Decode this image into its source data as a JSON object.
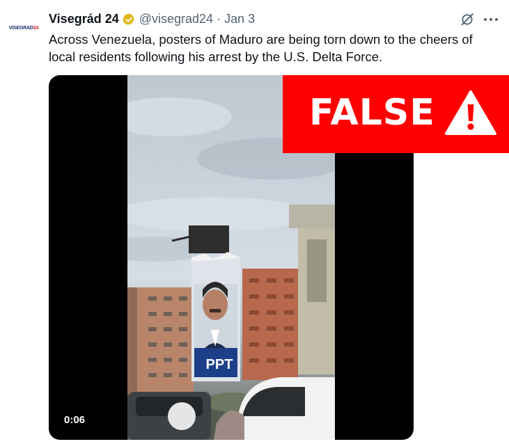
{
  "tweet": {
    "avatar_text_a": "VISEGRAD",
    "avatar_text_b": "24",
    "author_name": "Visegrád 24",
    "handle": "@visegrad24",
    "separator": "·",
    "date": "Jan 3",
    "text": "Across Venezuela, posters of Maduro are being torn down to the cheers of local residents following his arrest by the U.S. Delta Force."
  },
  "media": {
    "video_time": "0:06",
    "poster_text": "PPT"
  },
  "overlay": {
    "label": "FALSE",
    "color": "#ff0000"
  },
  "icons": [
    "verified-badge-icon",
    "grok-icon",
    "more-icon",
    "warning-icon"
  ],
  "colors": {
    "verified_gold": "#e2b719",
    "secondary_text": "#536471"
  }
}
